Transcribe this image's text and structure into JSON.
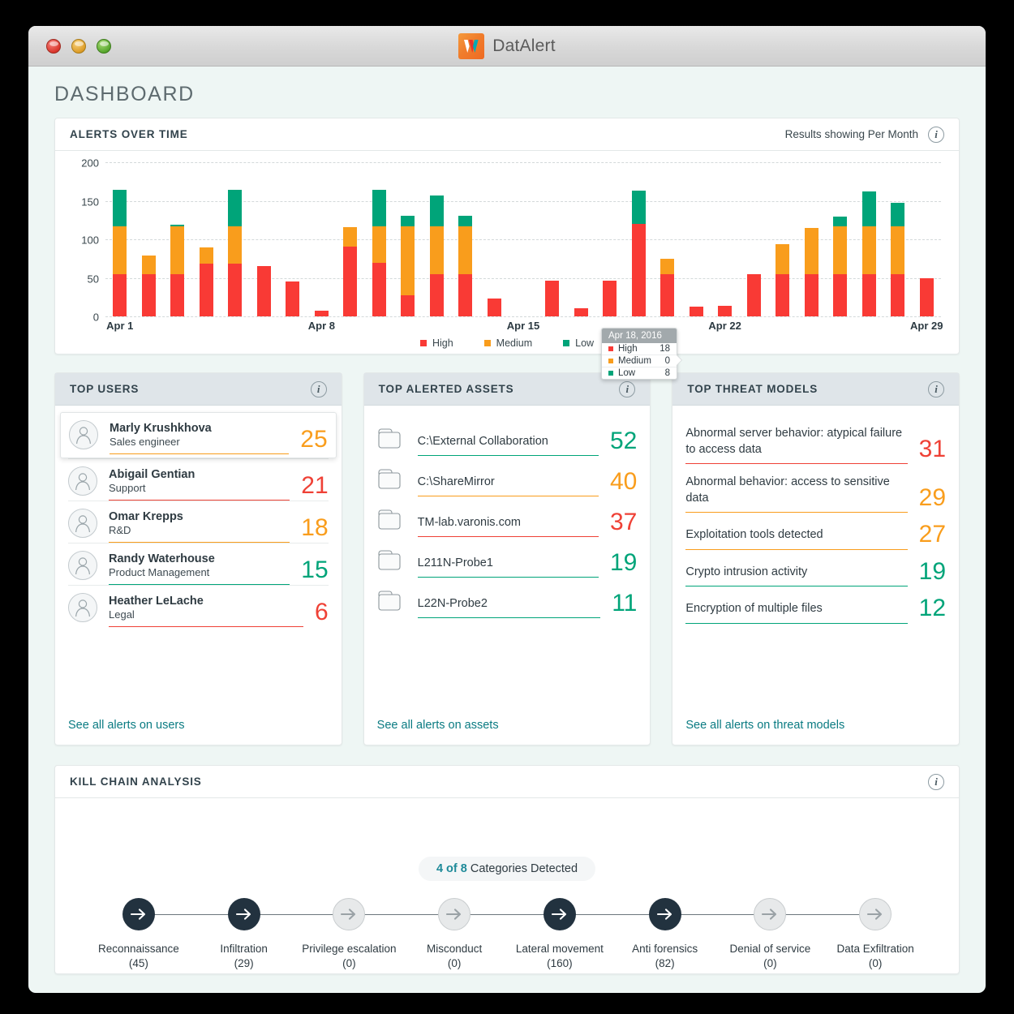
{
  "window": {
    "brand_name": "DatAlert",
    "traffic_lights": [
      "close-button",
      "minimize-button",
      "zoom-button"
    ]
  },
  "page_title": "DASHBOARD",
  "alerts_over_time": {
    "title": "ALERTS OVER TIME",
    "results_note": "Results showing Per Month",
    "info_label": "i",
    "tooltip": {
      "date": "Apr 18, 2016",
      "rows": [
        {
          "label": "High",
          "value": "18",
          "color": "#f93a35"
        },
        {
          "label": "Medium",
          "value": "0",
          "color": "#f99d1c"
        },
        {
          "label": "Low",
          "value": "8",
          "color": "#00a479"
        }
      ]
    }
  },
  "chart_data": {
    "type": "bar",
    "title": "Alerts Over Time",
    "subtitle": "Results showing Per Month",
    "stacked": true,
    "xlabel": "",
    "ylabel": "",
    "ylim": [
      0,
      200
    ],
    "yticks": [
      0,
      50,
      100,
      150,
      200
    ],
    "grid": true,
    "legend_position": "bottom",
    "categories": [
      "Apr 1",
      "Apr 2",
      "Apr 3",
      "Apr 4",
      "Apr 5",
      "Apr 6",
      "Apr 7",
      "Apr 8",
      "Apr 9",
      "Apr 10",
      "Apr 11",
      "Apr 12",
      "Apr 13",
      "Apr 14",
      "Apr 15",
      "Apr 16",
      "Apr 17",
      "Apr 18",
      "Apr 19",
      "Apr 20",
      "Apr 21",
      "Apr 22",
      "Apr 23",
      "Apr 24",
      "Apr 25",
      "Apr 26",
      "Apr 27",
      "Apr 28",
      "Apr 29"
    ],
    "tick_labels": [
      "Apr 1",
      "Apr 8",
      "Apr 15",
      "Apr 22",
      "Apr 29"
    ],
    "series": [
      {
        "name": "High",
        "color": "#f93a35",
        "values": [
          55,
          55,
          55,
          68,
          68,
          65,
          45,
          7,
          91,
          69,
          27,
          55,
          55,
          23,
          0,
          46,
          11,
          46,
          120,
          55,
          13,
          14,
          55,
          55,
          55,
          55,
          55,
          55,
          50
        ]
      },
      {
        "name": "Medium",
        "color": "#f99d1c",
        "values": [
          62,
          24,
          62,
          21,
          49,
          0,
          0,
          0,
          25,
          48,
          90,
          62,
          62,
          0,
          0,
          0,
          0,
          0,
          0,
          20,
          0,
          0,
          0,
          39,
          60,
          62,
          62,
          62,
          0
        ]
      },
      {
        "name": "Low",
        "color": "#00a479",
        "values": [
          47,
          0,
          2,
          0,
          47,
          0,
          0,
          0,
          0,
          47,
          14,
          40,
          14,
          0,
          0,
          0,
          0,
          0,
          43,
          0,
          0,
          0,
          0,
          0,
          0,
          13,
          45,
          30,
          0
        ]
      }
    ]
  },
  "top_users": {
    "title": "TOP USERS",
    "info_label": "i",
    "link": "See all alerts on users",
    "items": [
      {
        "name": "Marly Krushkhova",
        "role": "Sales engineer",
        "count": "25",
        "color": "#f99d1c",
        "highlighted": true
      },
      {
        "name": "Abigail Gentian",
        "role": "Support",
        "count": "21",
        "color": "#ef4136",
        "highlighted": false
      },
      {
        "name": "Omar Krepps",
        "role": "R&D",
        "count": "18",
        "color": "#f99d1c",
        "highlighted": false
      },
      {
        "name": "Randy Waterhouse",
        "role": "Product Management",
        "count": "15",
        "color": "#00a479",
        "highlighted": false
      },
      {
        "name": "Heather LeLache",
        "role": "Legal",
        "count": "6",
        "color": "#ef4136",
        "highlighted": false
      }
    ]
  },
  "top_assets": {
    "title": "TOP ALERTED ASSETS",
    "info_label": "i",
    "link": "See all alerts on assets",
    "items": [
      {
        "name": "C:\\External Collaboration",
        "count": "52",
        "color": "#00a479"
      },
      {
        "name": "C:\\ShareMirror",
        "count": "40",
        "color": "#f99d1c"
      },
      {
        "name": "TM-lab.varonis.com",
        "count": "37",
        "color": "#ef4136"
      },
      {
        "name": "L211N-Probe1",
        "count": "19",
        "color": "#00a479"
      },
      {
        "name": "L22N-Probe2",
        "count": "11",
        "color": "#00a479"
      }
    ]
  },
  "top_threat_models": {
    "title": "TOP THREAT MODELS",
    "info_label": "i",
    "link": "See all alerts on threat models",
    "items": [
      {
        "name": "Abnormal server behavior: atypical failure to access data",
        "count": "31",
        "color": "#ef4136"
      },
      {
        "name": "Abnormal behavior: access to sensitive data",
        "count": "29",
        "color": "#f99d1c"
      },
      {
        "name": "Exploitation tools detected",
        "count": "27",
        "color": "#f99d1c"
      },
      {
        "name": "Crypto intrusion activity",
        "count": "19",
        "color": "#00a479"
      },
      {
        "name": "Encryption of multiple files",
        "count": "12",
        "color": "#00a479"
      }
    ]
  },
  "kill_chain": {
    "title": "KILL CHAIN ANALYSIS",
    "info_label": "i",
    "badge_highlight": "4 of 8",
    "badge_text": " Categories Detected",
    "stages": [
      {
        "label": "Reconnaissance",
        "count": "(45)",
        "detected": true
      },
      {
        "label": "Infiltration",
        "count": "(29)",
        "detected": true
      },
      {
        "label": "Privilege escalation",
        "count": "(0)",
        "detected": false
      },
      {
        "label": "Misconduct",
        "count": "(0)",
        "detected": false
      },
      {
        "label": "Lateral movement",
        "count": "(160)",
        "detected": true
      },
      {
        "label": "Anti forensics",
        "count": "(82)",
        "detected": true
      },
      {
        "label": "Denial of service",
        "count": "(0)",
        "detected": false
      },
      {
        "label": "Data Exfiltration",
        "count": "(0)",
        "detected": false
      }
    ]
  }
}
